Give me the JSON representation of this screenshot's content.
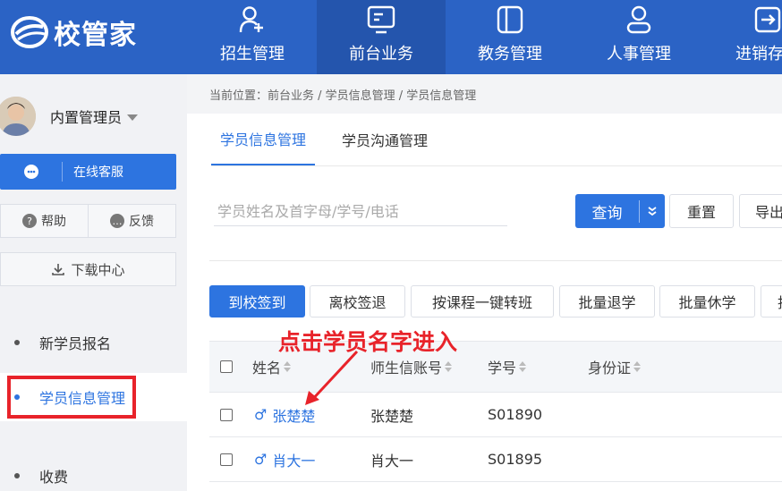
{
  "app": {
    "logo_text": "校管家"
  },
  "nav": [
    {
      "label": "招生管理",
      "icon": "user-add-icon"
    },
    {
      "label": "前台业务",
      "icon": "monitor-icon",
      "active": true
    },
    {
      "label": "教务管理",
      "icon": "book-icon"
    },
    {
      "label": "人事管理",
      "icon": "person-icon"
    },
    {
      "label": "进销存管",
      "icon": "inventory-icon"
    }
  ],
  "sidebar": {
    "user_name": "内置管理员",
    "service_label": "在线客服",
    "help_label": "帮助",
    "feedback_label": "反馈",
    "download_label": "下载中心",
    "menu": [
      {
        "label": "新学员报名"
      },
      {
        "label": "学员信息管理",
        "active": true
      },
      {
        "label": "收费"
      }
    ]
  },
  "breadcrumb": "当前位置：前台业务 / 学员信息管理 / 学员信息管理",
  "tabs": [
    {
      "label": "学员信息管理",
      "active": true
    },
    {
      "label": "学员沟通管理"
    }
  ],
  "search": {
    "placeholder": "学员姓名及首字母/学号/电话",
    "query_label": "查询",
    "reset_label": "重置",
    "export_label": "导出"
  },
  "actions": [
    {
      "label": "到校签到",
      "primary": true
    },
    {
      "label": "离校签退"
    },
    {
      "label": "按课程一键转班"
    },
    {
      "label": "批量退学"
    },
    {
      "label": "批量休学"
    },
    {
      "label": "批"
    }
  ],
  "annotation": "点击学员名字进入",
  "table": {
    "columns": [
      "姓名",
      "师生信账号",
      "学号",
      "身份证"
    ],
    "rows": [
      {
        "name": "张楚楚",
        "account": "张楚楚",
        "student_id": "S01890",
        "gender_icon": "male-icon"
      },
      {
        "name": "肖大一",
        "account": "肖大一",
        "student_id": "S01895",
        "gender_icon": "male-icon"
      }
    ]
  },
  "colors": {
    "header_bg": "#2b63c5",
    "primary": "#2d74e0",
    "annotation_red": "#e8232a"
  }
}
